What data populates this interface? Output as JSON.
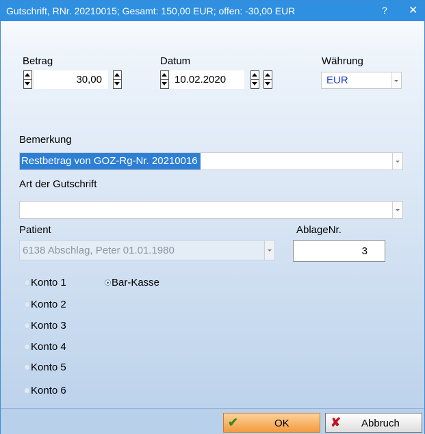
{
  "window": {
    "title": "Gutschrift, RNr. 20210015; Gesamt: 150,00 EUR; offen: -30,00 EUR",
    "help": "?",
    "close": "✕"
  },
  "betrag": {
    "label": "Betrag",
    "value": "30,00"
  },
  "datum": {
    "label": "Datum",
    "value": "10.02.2020"
  },
  "waehrung": {
    "label": "Währung",
    "value": "EUR"
  },
  "bemerkung": {
    "label": "Bemerkung",
    "value": "Restbetrag von GOZ-Rg-Nr. 20210016"
  },
  "art": {
    "label": "Art der Gutschrift",
    "value": ""
  },
  "patient": {
    "label": "Patient",
    "value": "6138 Abschlag, Peter  01.01.1980"
  },
  "ablage": {
    "label": "AblageNr.",
    "value": "3"
  },
  "konten": [
    {
      "label": "Konto 1"
    },
    {
      "label": "Konto 2"
    },
    {
      "label": "Konto 3"
    },
    {
      "label": "Konto 4"
    },
    {
      "label": "Konto 5"
    },
    {
      "label": "Konto 6"
    }
  ],
  "barkasse": {
    "label": "Bar-Kasse",
    "selected": true
  },
  "buttons": {
    "ok": "OK",
    "cancel": "Abbruch"
  },
  "colors": {
    "titlebar": "#2f8fe0",
    "selection": "#2d7fd6",
    "ok_button": "#f7a64a"
  }
}
